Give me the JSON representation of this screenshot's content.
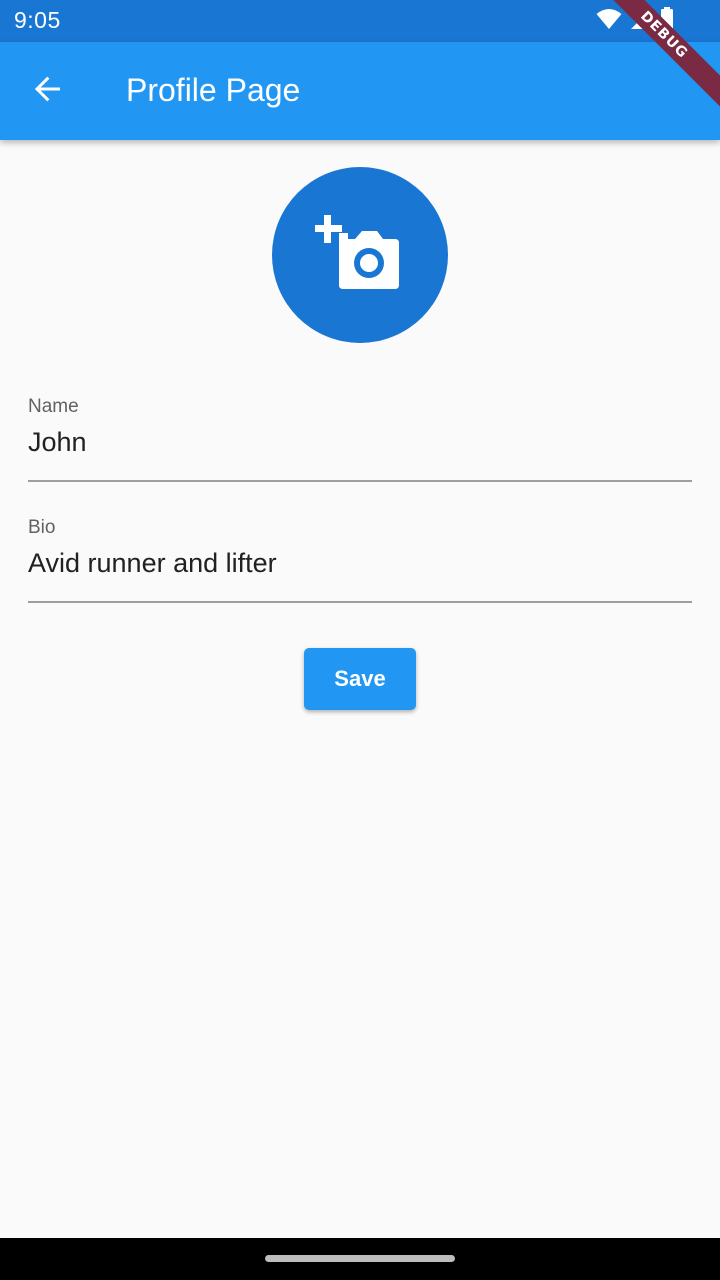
{
  "status_bar": {
    "time": "9:05",
    "icons": [
      "wifi-icon",
      "signal-icon",
      "battery-icon"
    ]
  },
  "debug_banner": "DEBUG",
  "app_bar": {
    "title": "Profile Page",
    "back_icon": "arrow-back-icon"
  },
  "avatar": {
    "icon": "add-a-photo-icon"
  },
  "form": {
    "name": {
      "label": "Name",
      "value": "John"
    },
    "bio": {
      "label": "Bio",
      "value": "Avid runner and lifter"
    }
  },
  "save_button": {
    "label": "Save"
  },
  "colors": {
    "status_bar": "#1976d2",
    "app_bar": "#2196f3",
    "avatar": "#1976d2",
    "button": "#2196f3",
    "background": "#fafafa",
    "debug_banner": "#7a2a43"
  }
}
